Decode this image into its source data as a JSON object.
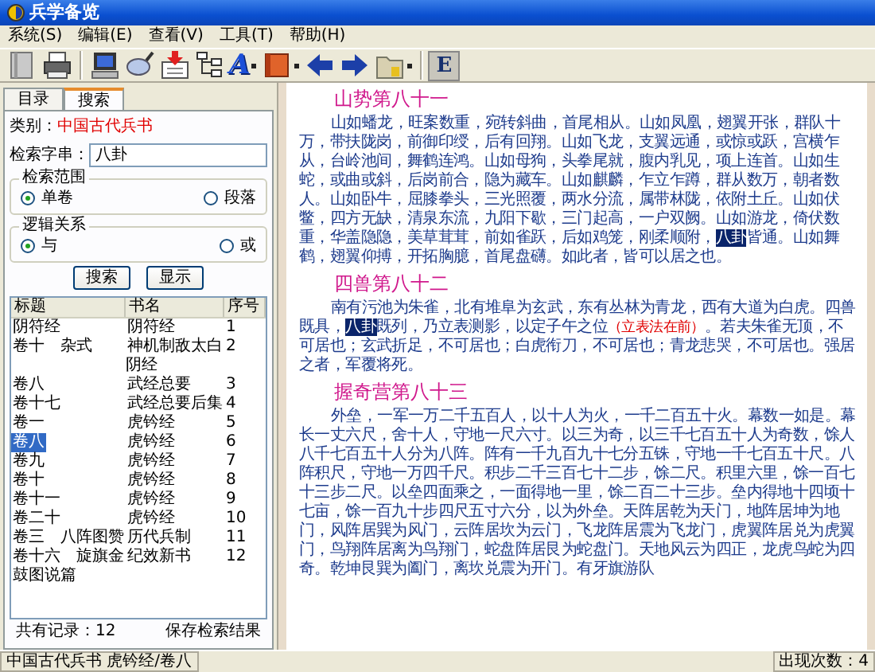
{
  "window": {
    "title": "兵学备览"
  },
  "menu": [
    "系统(S)",
    "编辑(E)",
    "查看(V)",
    "工具(T)",
    "帮助(H)"
  ],
  "toolbar": [
    {
      "kind": "book"
    },
    {
      "kind": "printer"
    },
    {
      "kind": "separator"
    },
    {
      "kind": "monitor"
    },
    {
      "kind": "magnifier"
    },
    {
      "kind": "inbox"
    },
    {
      "kind": "tree"
    },
    {
      "kind": "letter",
      "text": "A",
      "dropdown": true
    },
    {
      "kind": "redbook",
      "dropdown": true
    },
    {
      "kind": "back"
    },
    {
      "kind": "forward"
    },
    {
      "kind": "folder",
      "dropdown": true
    },
    {
      "kind": "separator"
    },
    {
      "kind": "letterbox",
      "text": "E"
    }
  ],
  "tabs": [
    {
      "label": "目录",
      "selected": false
    },
    {
      "label": "搜索",
      "selected": true
    }
  ],
  "search": {
    "category_label": "类别：",
    "category": "中国古代兵书",
    "field_label": "检索字串：",
    "value": "八卦",
    "groups": [
      {
        "title": "检索范围",
        "options": [
          {
            "label": "单卷",
            "selected": true
          },
          {
            "label": "段落",
            "selected": false
          }
        ]
      },
      {
        "title": "逻辑关系",
        "options": [
          {
            "label": "与",
            "selected": true
          },
          {
            "label": "或",
            "selected": false
          }
        ]
      }
    ],
    "buttons": [
      "搜索",
      "显示"
    ]
  },
  "results": {
    "columns": [
      "标题",
      "书名",
      "序号"
    ],
    "rows": [
      {
        "cells": [
          "阴符经",
          "阴符经",
          "1"
        ],
        "selected": false
      },
      {
        "cells": [
          "卷十　杂式",
          "神机制敌太白阴经",
          "2"
        ],
        "selected": false
      },
      {
        "cells": [
          "卷八",
          "武经总要",
          "3"
        ],
        "selected": false
      },
      {
        "cells": [
          "卷十七",
          "武经总要后集",
          "4"
        ],
        "selected": false
      },
      {
        "cells": [
          "卷一",
          "虎钤经",
          "5"
        ],
        "selected": false
      },
      {
        "cells": [
          "卷八",
          "虎钤经",
          "6"
        ],
        "selected": true
      },
      {
        "cells": [
          "卷九",
          "虎钤经",
          "7"
        ],
        "selected": false
      },
      {
        "cells": [
          "卷十",
          "虎钤经",
          "8"
        ],
        "selected": false
      },
      {
        "cells": [
          "卷十一",
          "虎钤经",
          "9"
        ],
        "selected": false
      },
      {
        "cells": [
          "卷二十",
          "虎钤经",
          "10"
        ],
        "selected": false
      },
      {
        "cells": [
          "卷三　八阵图赞",
          "历代兵制",
          "11"
        ],
        "selected": false
      },
      {
        "cells": [
          "卷十六　旋旗金鼓图说篇",
          "纪效新书",
          "12"
        ],
        "selected": false
      }
    ],
    "count": "共有记录：12",
    "save": "保存检索结果"
  },
  "document": [
    {
      "title": "山势第八十一",
      "paragraph": [
        {
          "kind": "text",
          "text": "山如蟠龙，旺案数重，宛转斜曲，首尾相从。山如凤凰，翅翼开张，群队十万，带扶陇岗，前御印绶，后有回翔。山如飞龙，支翼远通，或惊或跃，宫横乍从，台岭池间，舞鹤连鸿。山如母狗，头拳尾就，腹内乳见，项上连首。山如生蛇，或曲或斜，后岗前合，隐为藏车。山如麒麟，乍立乍蹲，群从数万，朝者数人。山如卧牛，屈膝拳头，三光照覆，两水分流，属带林陇，依附土丘。山如伏鳖，四方无缺，清泉东流，九阳下歇，三门起高，一户双阙。山如游龙，倚伏数重，华盖隐隐，美草茸茸，前如雀跃，后如鸡笼，刚柔顺附，"
        },
        {
          "kind": "hit",
          "text": "八卦"
        },
        {
          "kind": "text",
          "text": "皆通。山如舞鹤，翅翼仰搏，开拓胸臆，首尾盘礴。如此者，皆可以居之也。"
        }
      ]
    },
    {
      "title": "四兽第八十二",
      "paragraph": [
        {
          "kind": "text",
          "text": "南有污池为朱雀，北有堆阜为玄武，东有丛林为青龙，西有大道为白虎。四兽既具，"
        },
        {
          "kind": "hit",
          "text": "八卦"
        },
        {
          "kind": "text",
          "text": "既列，乃立表测影，以定子午之位"
        },
        {
          "kind": "note",
          "text": "（立表法在前）"
        },
        {
          "kind": "text",
          "text": "。若夫朱雀无顶，不可居也；玄武折足，不可居也；白虎衔刀，不可居也；青龙悲哭，不可居也。强居之者，军覆将死。"
        }
      ]
    },
    {
      "title": "握奇营第八十三",
      "paragraph": [
        {
          "kind": "text",
          "text": "外垒，一军一万二千五百人，以十人为火，一千二百五十火。幕数一如是。幕长一丈六尺，舍十人，守地一尺六寸。以三为奇，以三千七百五十人为奇数，馀人八千七百五十人分为八阵。阵有一千九百九十七分五铢，守地一千七百五十尺。八阵积尺，守地一万四千尺。积步二千三百七十二步，馀二尺。积里六里，馀一百七十三步二尺。以垒四面乘之，一面得地一里，馀二百二十三步。垒内得地十四顷十七亩，馀一百九十步四尺五寸六分，以为外垒。天阵居乾为天门，地阵居坤为地门，风阵居巽为风门，云阵居坎为云门，飞龙阵居震为飞龙门，虎翼阵居兑为虎翼门，鸟翔阵居离为鸟翔门，蛇盘阵居艮为蛇盘门。天地风云为四正，龙虎鸟蛇为四奇。乾坤艮巽为阖门，离坎兑震为开门。有牙旗游队"
        }
      ]
    }
  ],
  "status_bar": {
    "location": "中国古代兵书 虎钤经/卷八",
    "occurrences": "出现次数：4"
  }
}
